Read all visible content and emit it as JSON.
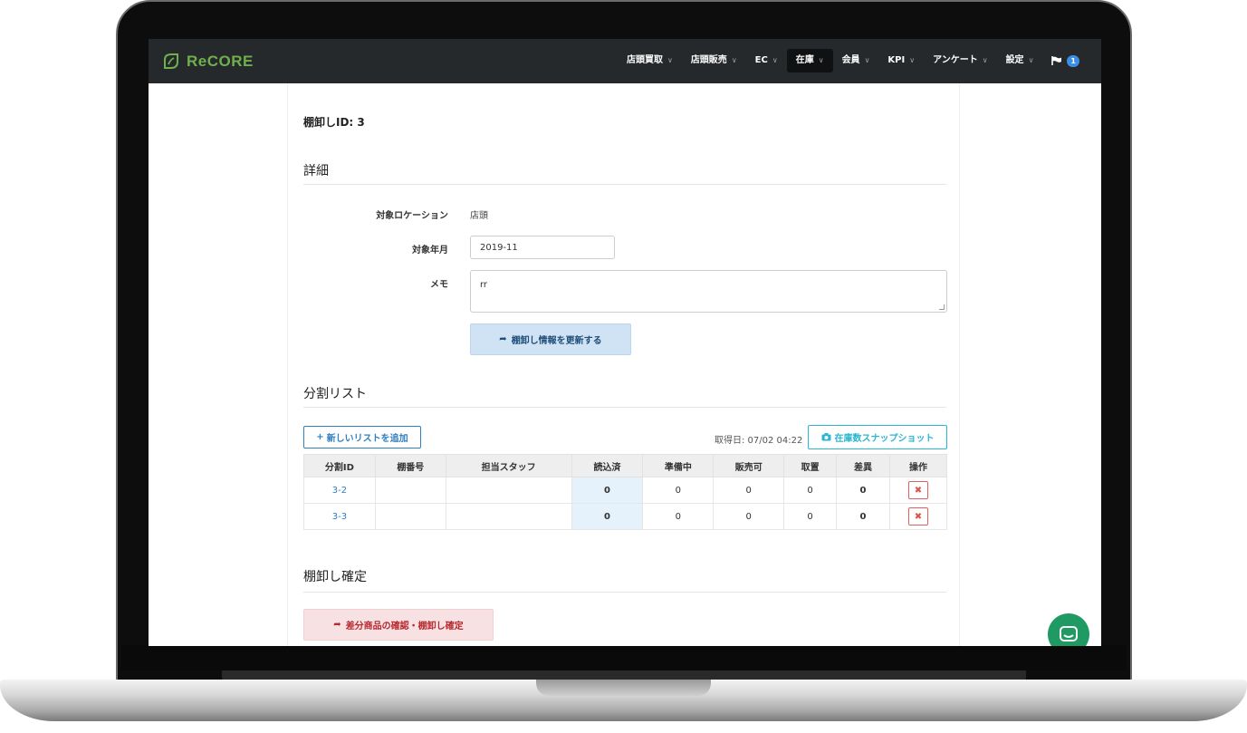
{
  "brand": {
    "name": "ReCORE",
    "color": "#6fb04d"
  },
  "nav": {
    "items": [
      {
        "label": "店頭買取",
        "active": false
      },
      {
        "label": "店頭販売",
        "active": false
      },
      {
        "label": "EC",
        "active": false
      },
      {
        "label": "在庫",
        "active": true
      },
      {
        "label": "会員",
        "active": false
      },
      {
        "label": "KPI",
        "active": false
      },
      {
        "label": "アンケート",
        "active": false
      },
      {
        "label": "設定",
        "active": false
      }
    ],
    "notification_count": "1"
  },
  "page": {
    "title": "棚卸しID: 3"
  },
  "details": {
    "heading": "詳細",
    "location_label": "対象ロケーション",
    "location_value": "店頭",
    "month_label": "対象年月",
    "month_value": "2019-11",
    "memo_label": "メモ",
    "memo_value": "rr",
    "update_button": "棚卸し情報を更新する"
  },
  "split_list": {
    "heading": "分割リスト",
    "add_button": "新しいリストを追加",
    "fetch_date": "取得日: 07/02 04:22",
    "snapshot_button": "在庫数スナップショット",
    "columns": [
      "分割ID",
      "棚番号",
      "担当スタッフ",
      "読込済",
      "準備中",
      "販売可",
      "取置",
      "差異",
      "操作"
    ],
    "rows": [
      {
        "id": "3-2",
        "shelf": "",
        "staff": "",
        "read": "0",
        "preparing": "0",
        "sellable": "0",
        "reserved": "0",
        "diff": "0"
      },
      {
        "id": "3-3",
        "shelf": "",
        "staff": "",
        "read": "0",
        "preparing": "0",
        "sellable": "0",
        "reserved": "0",
        "diff": "0"
      }
    ],
    "delete_symbol": "✖"
  },
  "confirm": {
    "heading": "棚卸し確定",
    "button": "差分商品の確認・棚卸し確定"
  },
  "colors": {
    "navbar": "#26292c",
    "link": "#2f7fc4",
    "danger": "#d9534f",
    "chat": "#1f9a63"
  }
}
